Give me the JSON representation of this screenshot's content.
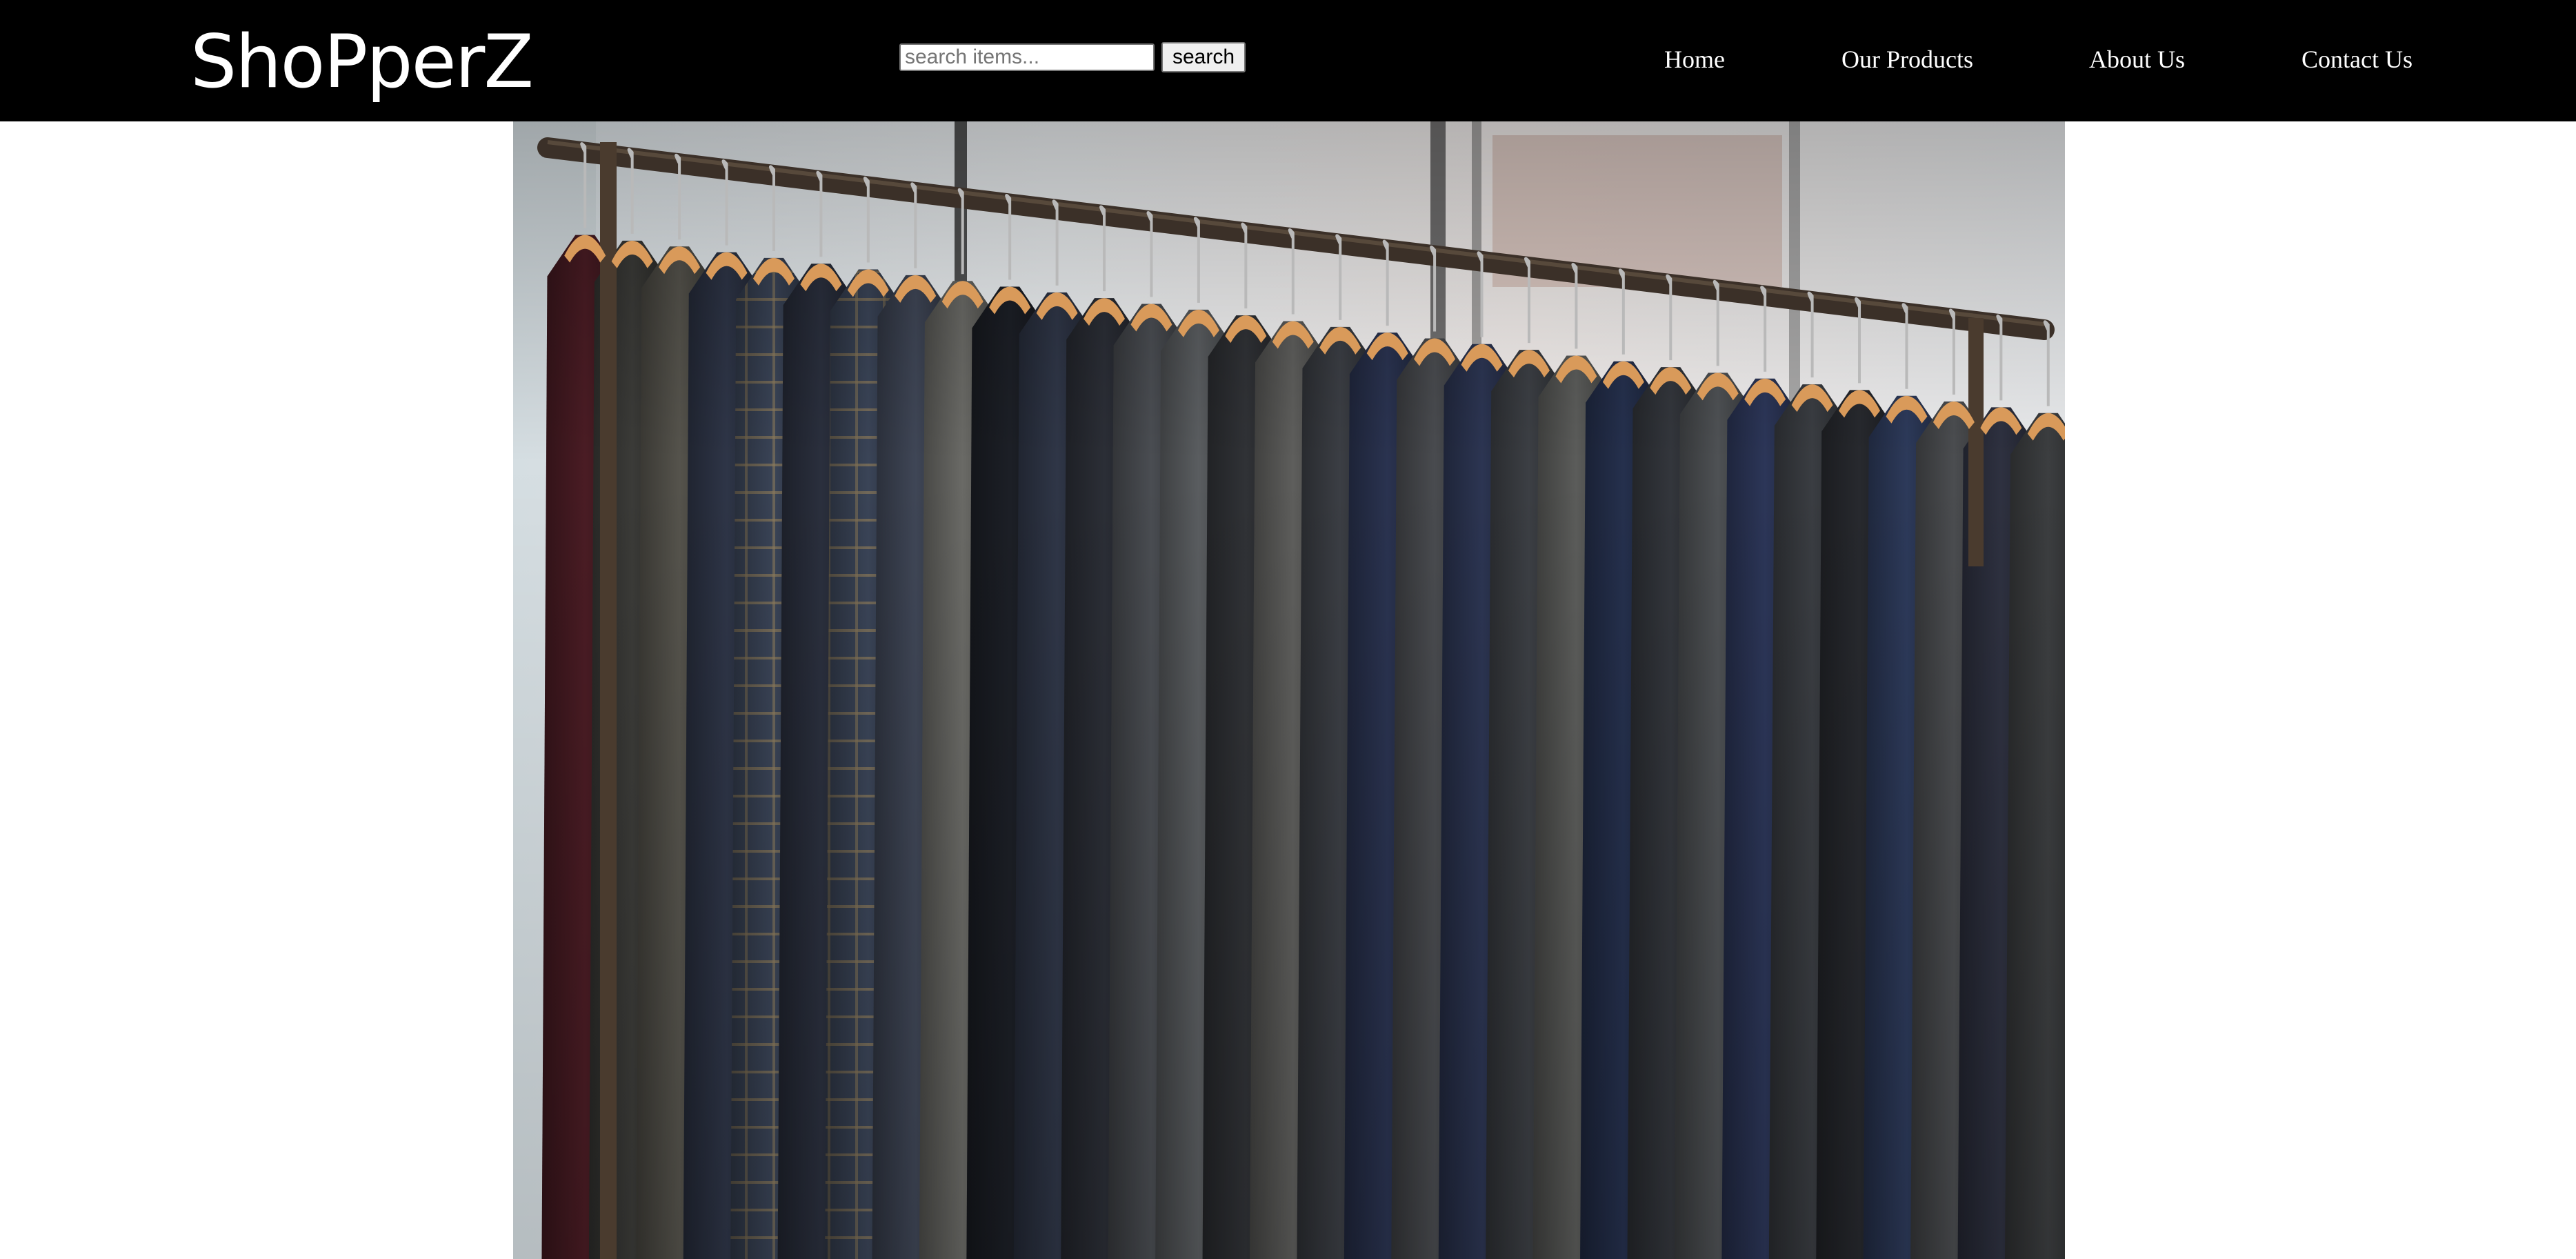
{
  "header": {
    "logo_text": "ShoPperZ",
    "background": "#000000"
  },
  "search": {
    "placeholder": "search items...",
    "value": "",
    "button_label": "search"
  },
  "nav": {
    "items": [
      {
        "label": "Home"
      },
      {
        "label": "Our Products"
      },
      {
        "label": "About Us"
      },
      {
        "label": "Contact Us"
      }
    ]
  },
  "hero": {
    "image": "rack-of-suit-jackets-photo"
  }
}
